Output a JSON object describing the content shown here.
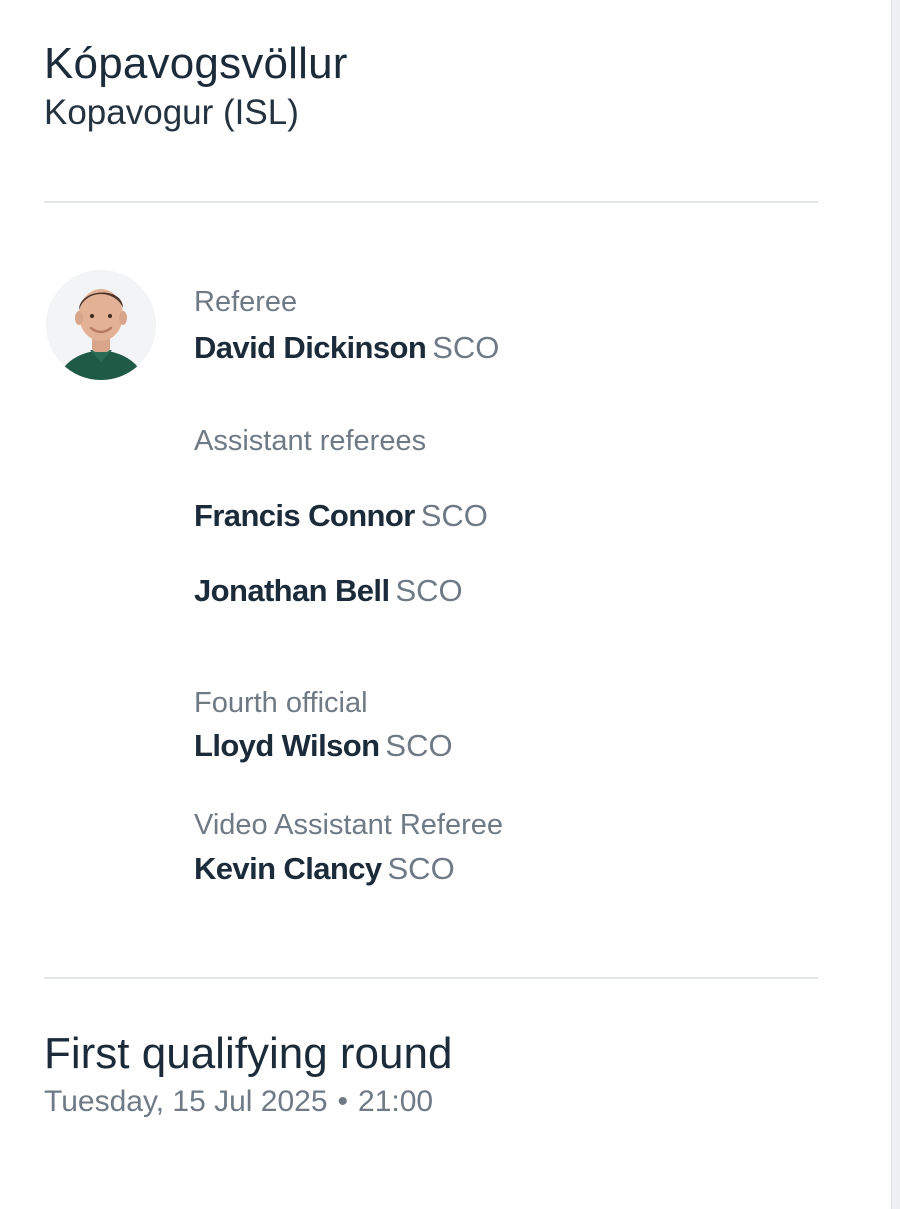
{
  "venue": {
    "stadium_name": "Kópavogsvöllur",
    "city": "Kopavogur (ISL)"
  },
  "officials": {
    "referee": {
      "role": "Referee",
      "name": "David Dickinson",
      "nationality": "SCO"
    },
    "assistants": {
      "role": "Assistant referees",
      "people": [
        {
          "name": "Francis Connor",
          "nationality": "SCO"
        },
        {
          "name": "Jonathan Bell",
          "nationality": "SCO"
        }
      ]
    },
    "fourth_official": {
      "role": "Fourth official",
      "name": "Lloyd Wilson",
      "nationality": "SCO"
    },
    "var": {
      "role": "Video Assistant Referee",
      "name": "Kevin Clancy",
      "nationality": "SCO"
    }
  },
  "match": {
    "round": "First qualifying round",
    "date": "Tuesday, 15 Jul 2025",
    "separator": "•",
    "time": "21:00"
  },
  "colors": {
    "text_primary": "#1c2b3a",
    "text_secondary": "#6f7a85",
    "divider": "#e3e6ea",
    "referee_shirt": "#1f5a47"
  }
}
